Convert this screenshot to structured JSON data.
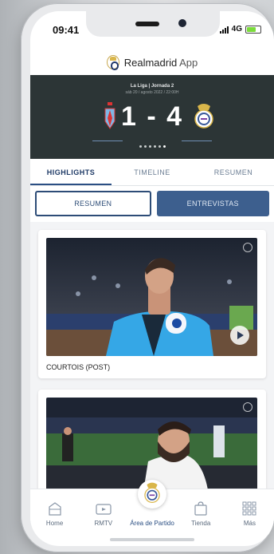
{
  "status": {
    "time": "09:41",
    "network": "4G"
  },
  "app": {
    "brand": "Realmadrid",
    "suffix": "App"
  },
  "match": {
    "league": "La Liga | Jornada 2",
    "date": "sáb 20 / agosto 2022 / 22:00H",
    "score": "1 - 4",
    "home_team_icon": "celta-crest-icon",
    "away_team_icon": "real-madrid-crest-icon",
    "carousel_dots": 6,
    "active_dot": 5
  },
  "tabs": [
    {
      "label": "HIGHLIGHTS",
      "active": true
    },
    {
      "label": "TIMELINE",
      "active": false
    },
    {
      "label": "RESUMEN",
      "active": false
    }
  ],
  "toggles": {
    "left": "RESUMEN",
    "right": "ENTREVISTAS"
  },
  "cards": [
    {
      "caption": "COURTOIS (POST)"
    },
    {
      "caption": ""
    }
  ],
  "nav": [
    {
      "label": "Home",
      "icon": "stadium-icon"
    },
    {
      "label": "RMTV",
      "icon": "tv-icon"
    },
    {
      "label": "Área de Partido",
      "icon": "real-madrid-crest-icon"
    },
    {
      "label": "Tienda",
      "icon": "shopping-bag-icon"
    },
    {
      "label": "Más",
      "icon": "grid-icon"
    }
  ],
  "colors": {
    "primary": "#2b4f83",
    "score_bg": "#2c3536",
    "accent_gold": "#d9b64a"
  }
}
